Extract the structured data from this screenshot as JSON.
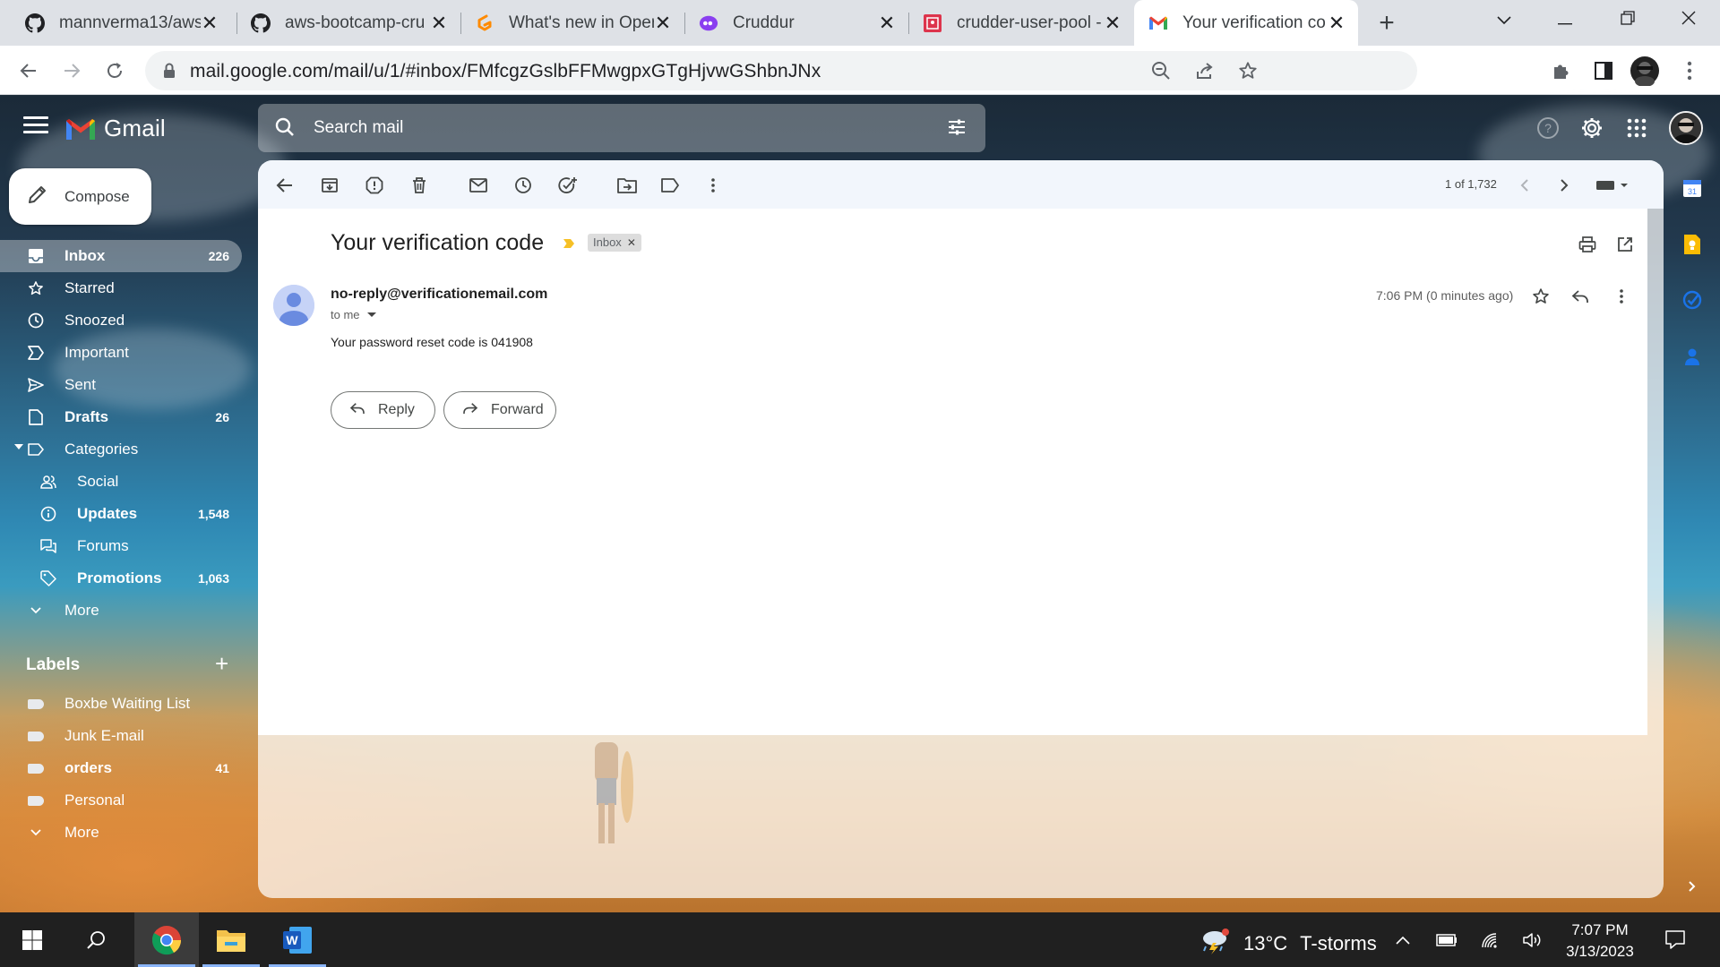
{
  "browser": {
    "tabs": [
      {
        "title": "mannverma13/aws-",
        "favicon": "github-icon",
        "active": false
      },
      {
        "title": "aws-bootcamp-cru",
        "favicon": "github-icon",
        "active": false
      },
      {
        "title": "What's new in Oper",
        "favicon": "gitpod-icon",
        "active": false
      },
      {
        "title": "Cruddur",
        "favicon": "cruddur-icon",
        "active": false
      },
      {
        "title": "crudder-user-pool -",
        "favicon": "aws-cognito-icon",
        "active": false
      },
      {
        "title": "Your verification co",
        "favicon": "gmail-icon",
        "active": true
      }
    ],
    "url": "mail.google.com/mail/u/1/#inbox/FMfcgzGslbFFMwgpxGTgHjvwGShbnJNx"
  },
  "gmail": {
    "logo_text": "Gmail",
    "search_placeholder": "Search mail",
    "compose_label": "Compose",
    "nav": [
      {
        "label": "Inbox",
        "count": "226",
        "icon": "inbox-icon",
        "bold": true,
        "active": true
      },
      {
        "label": "Starred",
        "count": "",
        "icon": "star-icon",
        "bold": false
      },
      {
        "label": "Snoozed",
        "count": "",
        "icon": "clock-icon",
        "bold": false
      },
      {
        "label": "Important",
        "count": "",
        "icon": "important-icon",
        "bold": false
      },
      {
        "label": "Sent",
        "count": "",
        "icon": "send-icon",
        "bold": false
      },
      {
        "label": "Drafts",
        "count": "26",
        "icon": "draft-icon",
        "bold": true
      },
      {
        "label": "Categories",
        "count": "",
        "icon": "label-icon",
        "bold": false
      }
    ],
    "categories": [
      {
        "label": "Social",
        "count": "",
        "icon": "people-icon",
        "bold": false
      },
      {
        "label": "Updates",
        "count": "1,548",
        "icon": "info-icon",
        "bold": true
      },
      {
        "label": "Forums",
        "count": "",
        "icon": "forum-icon",
        "bold": false
      },
      {
        "label": "Promotions",
        "count": "1,063",
        "icon": "tag-icon",
        "bold": true
      }
    ],
    "more_label": "More",
    "labels_title": "Labels",
    "labels": [
      {
        "label": "Boxbe Waiting List",
        "count": "",
        "bold": false
      },
      {
        "label": "Junk E-mail",
        "count": "",
        "bold": false
      },
      {
        "label": "orders",
        "count": "41",
        "bold": true
      },
      {
        "label": "Personal",
        "count": "",
        "bold": false
      }
    ],
    "labels_more": "More"
  },
  "message": {
    "pager": "1 of 1,732",
    "subject": "Your verification code",
    "chip": "Inbox",
    "sender": "no-reply@verificationemail.com",
    "to": "to me",
    "time": "7:06 PM (0 minutes ago)",
    "body": "Your password reset code is 041908",
    "reply_label": "Reply",
    "forward_label": "Forward"
  },
  "taskbar": {
    "weather_temp": "13°C",
    "weather_desc": "T-storms",
    "time": "7:07 PM",
    "date": "3/13/2023"
  }
}
